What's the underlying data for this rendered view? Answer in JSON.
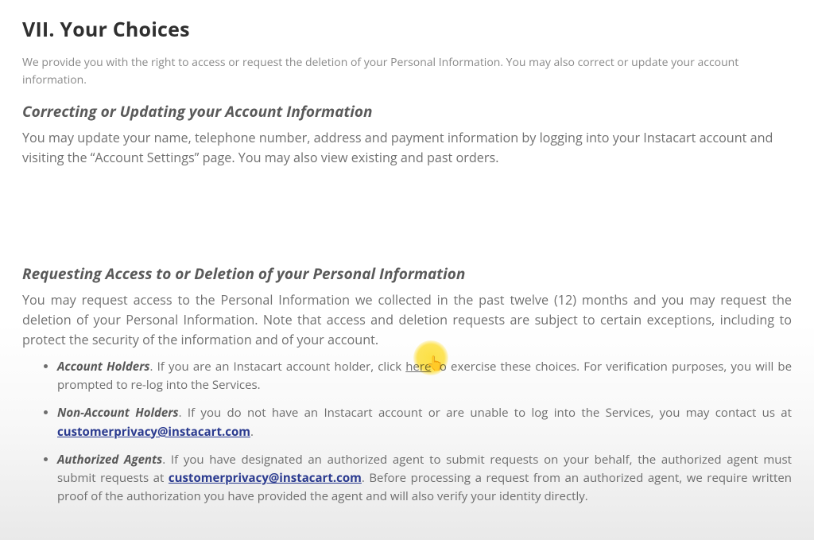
{
  "title": "VII. Your Choices",
  "intro": "We provide you with the right to access or request the deletion of your Personal Information. You may also correct or update your account information.",
  "section1": {
    "heading": "Correcting or Updating your Account Information",
    "body": "You may update your name, telephone number, address and payment information by logging into your Instacart account and visiting the “Account Settings” page. You may also view existing and past orders."
  },
  "section2": {
    "heading": "Requesting Access to or Deletion of your Personal Information",
    "body": "You may request access to the Personal Information we collected in the past twelve (12) months and you may request the deletion of your Personal Information. Note that access and deletion requests are subject to certain exceptions, including to protect the security of the information and of your account."
  },
  "bullets": {
    "b1": {
      "lead": "Account Holders",
      "pre": ". If you are an Instacart account holder, click ",
      "link": "here",
      "post": " to exercise these choices. For verification purposes, you will be prompted to re-log into the Services."
    },
    "b2": {
      "lead": "Non-Account Holders",
      "pre": ". If you do not have an Instacart account or are unable to log into the Services, you may contact us at ",
      "email": "customerprivacy@instacart.com",
      "post": "."
    },
    "b3": {
      "lead": "Authorized Agents",
      "pre": ". If you have designated an authorized agent to submit requests on your behalf, the authorized agent must submit requests at ",
      "email": "customerprivacy@instacart.com",
      "post": ". Before processing a request from an authorized agent, we require written proof of the authorization you have provided the agent and will also verify your identity directly."
    }
  }
}
